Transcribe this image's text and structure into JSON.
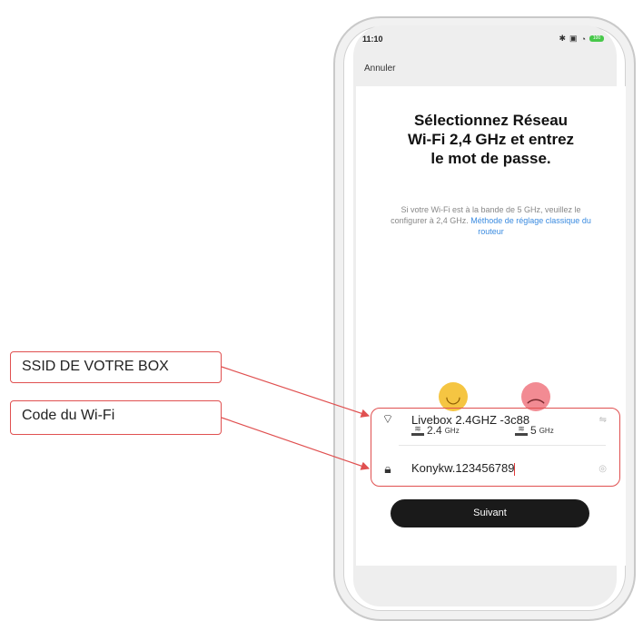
{
  "status_bar": {
    "time": "11:10",
    "icons": [
      "bluetooth-icon",
      "vibrate-icon",
      "wifi-icon",
      "battery-icon"
    ],
    "battery": "100"
  },
  "header": {
    "cancel_label": "Annuler"
  },
  "main": {
    "title": "Sélectionnez Réseau Wi-Fi 2,4 GHz et entrez le mot de passe.",
    "subtitle": "Si votre Wi-Fi est à  la bande de 5 GHz, veuillez le configurer à 2,4 GHz.",
    "subtitle_link": "Méthode de réglage classique du routeur",
    "band_good": {
      "value": "2.4",
      "unit": "GHz"
    },
    "band_bad": {
      "value": "5",
      "unit": "GHz"
    }
  },
  "form": {
    "ssid_value": "Livebox 2.4GHZ -3c88",
    "password_value": "Konykw.123456789",
    "next_label": "Suivant"
  },
  "annotations": {
    "ssid_callout": "SSID DE VOTRE BOX",
    "code_callout": "Code du Wi-Fi",
    "color": "#e05050"
  },
  "nav_bar": {
    "items": [
      "square-icon",
      "circle-icon",
      "back-triangle-icon"
    ]
  },
  "colors": {
    "link": "#3a8be0",
    "button": "#1a1a1a",
    "good_face": "#f5c542",
    "bad_face": "#f28b93"
  }
}
